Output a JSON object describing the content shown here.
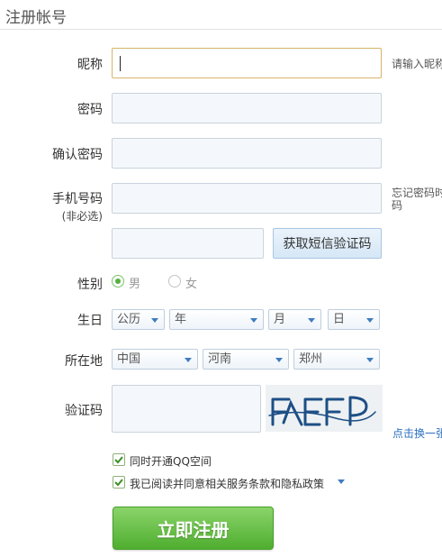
{
  "page": {
    "title": "注册帐号"
  },
  "form": {
    "nickname": {
      "label": "昵称",
      "value": "",
      "hint": "请输入昵称"
    },
    "password": {
      "label": "密码",
      "value": ""
    },
    "confirm_password": {
      "label": "确认密码",
      "value": ""
    },
    "phone": {
      "label": "手机号码",
      "sub_label": "(非必选)",
      "value": "",
      "hint_line1": "忘记密码时",
      "hint_line2": "码"
    },
    "sms": {
      "value": "",
      "button_label": "获取短信验证码"
    },
    "gender": {
      "label": "性别",
      "options": [
        "男",
        "女"
      ],
      "selected": "男"
    },
    "birthday": {
      "label": "生日",
      "calendar": "公历",
      "year": "年",
      "month": "月",
      "day": "日"
    },
    "location": {
      "label": "所在地",
      "country": "中国",
      "province": "河南",
      "city": "郑州"
    },
    "captcha": {
      "label": "验证码",
      "value": "",
      "image_text": "FEFP",
      "refresh_label": "点击换一张"
    },
    "qzone": {
      "label": "同时开通QQ空间",
      "checked": true
    },
    "agree": {
      "label": "我已阅读并同意相关服务条款和隐私政策",
      "checked": true
    },
    "submit_label": "立即注册"
  },
  "colors": {
    "accent": "#53b13f",
    "link": "#2b6fc2",
    "focus_border": "#d9b56b",
    "input_bg": "#f4f8fc"
  }
}
